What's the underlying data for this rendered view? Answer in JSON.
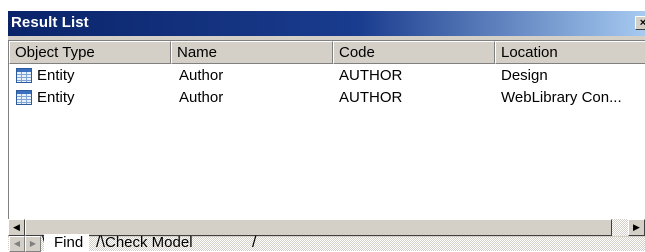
{
  "window": {
    "title": "Result List",
    "close_glyph": "×"
  },
  "columns": [
    "Object Type",
    "Name",
    "Code",
    "Location"
  ],
  "rows": [
    {
      "type": "Entity",
      "name": "Author",
      "code": "AUTHOR",
      "location": "Design",
      "icon": "entity-icon"
    },
    {
      "type": "Entity",
      "name": "Author",
      "code": "AUTHOR",
      "location": "WebLibrary Con...",
      "icon": "entity-icon"
    }
  ],
  "scrollbar": {
    "left_arrow": "◀",
    "right_arrow": "▶"
  },
  "tabs": {
    "nav_left": "◀",
    "nav_right": "▶",
    "items": [
      "Find",
      "Check Model"
    ],
    "active": "Find"
  }
}
